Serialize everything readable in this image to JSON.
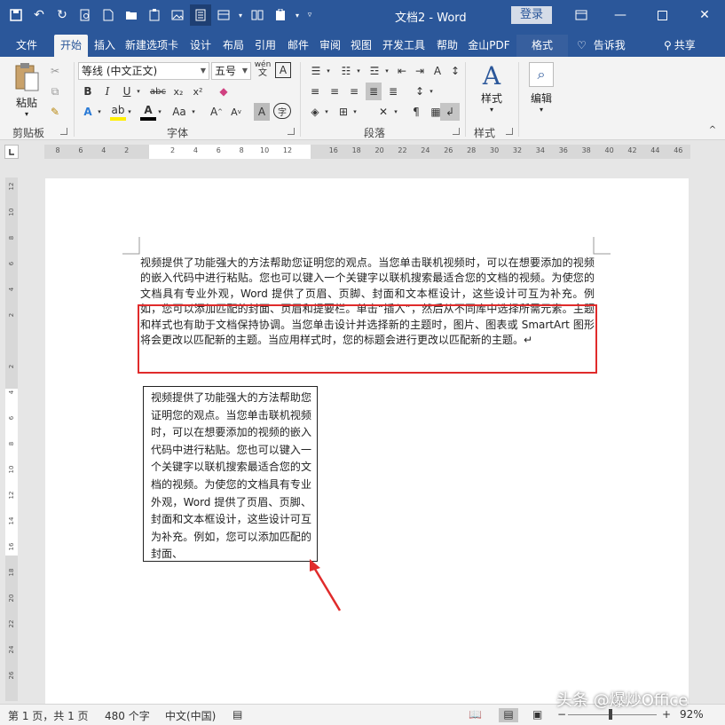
{
  "window": {
    "title": "文档2  -  Word",
    "login": "登录"
  },
  "tabs": [
    "文件",
    "开始",
    "插入",
    "新建选项卡",
    "设计",
    "布局",
    "引用",
    "邮件",
    "审阅",
    "视图",
    "开发工具",
    "帮助",
    "金山PDF",
    "格式"
  ],
  "tellme": "告诉我",
  "share": "共享",
  "ribbon": {
    "clipboard": {
      "label": "剪贴板",
      "paste": "粘贴"
    },
    "font": {
      "label": "字体",
      "font_name": "等线 (中文正文)",
      "font_size": "五号",
      "wen": "wén",
      "a_box": "A"
    },
    "paragraph": {
      "label": "段落"
    },
    "styles": {
      "label": "样式",
      "btn": "样式"
    },
    "editing": {
      "btn": "编辑"
    }
  },
  "ruler": {
    "h_labels": [
      "8",
      "6",
      "4",
      "2",
      "",
      "2",
      "4",
      "6",
      "8",
      "10",
      "12",
      "",
      "16",
      "18",
      "20",
      "22",
      "24",
      "26",
      "28",
      "30",
      "32",
      "34",
      "36",
      "38",
      "40",
      "42",
      "44",
      "46"
    ],
    "v_labels": [
      "12",
      "10",
      "8",
      "6",
      "4",
      "2",
      "",
      "2",
      "4",
      "6",
      "8",
      "10",
      "12",
      "14",
      "16",
      "18",
      "20",
      "22",
      "24",
      "26"
    ]
  },
  "document": {
    "paragraph": "视频提供了功能强大的方法帮助您证明您的观点。当您单击联机视频时，可以在想要添加的视频的嵌入代码中进行粘贴。您也可以键入一个关键字以联机搜索最适合您的文档的视频。为使您的文档具有专业外观，Word 提供了页眉、页脚、封面和文本框设计，这些设计可互为补充。例如，您可以添加匹配的封面、页眉和提要栏。单击“插入”，然后从不同库中选择所需元素。主题和样式也有助于文档保持协调。当您单击设计并选择新的主题时，图片、图表或 SmartArt 图形将会更改以匹配新的主题。当应用样式时，您的标题会进行更改以匹配新的主题。↵",
    "textbox": "视频提供了功能强大的方法帮助您证明您的观点。当您单击联机视频时，可以在想要添加的视频的嵌入代码中进行粘贴。您也可以键入一个关键字以联机搜索最适合您的文档的视频。为使您的文档具有专业外观，Word 提供了页眉、页脚、封面和文本框设计，这些设计可互为补充。例如，您可以添加匹配的封面、"
  },
  "status": {
    "page": "第 1 页，共 1 页",
    "words": "480 个字",
    "language": "中文(中国)",
    "zoom": "92%"
  },
  "watermark": "头条 @爆炒Office",
  "colors": {
    "accent": "#2b579a",
    "annotation": "#e02b2b"
  }
}
